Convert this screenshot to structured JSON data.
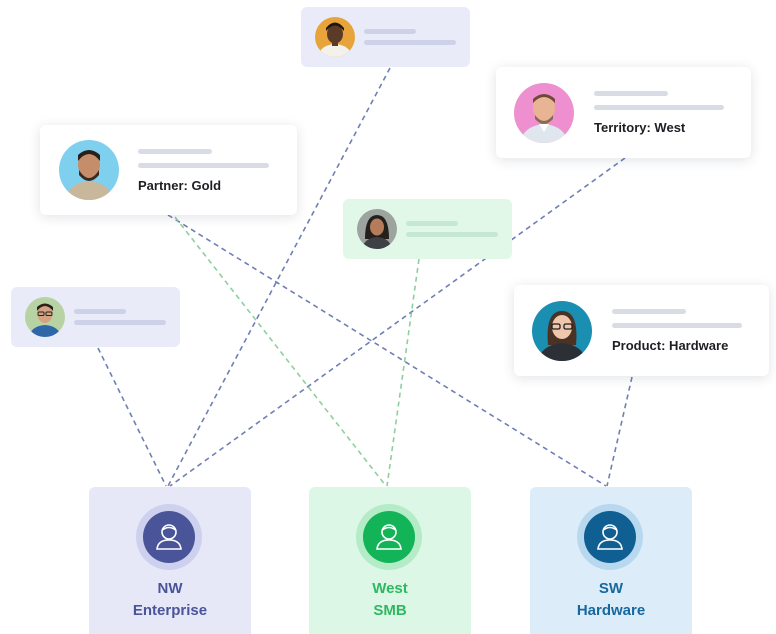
{
  "cards": {
    "partner": {
      "label": "Partner: Gold"
    },
    "territory": {
      "label": "Territory: West"
    },
    "product": {
      "label": "Product: Hardware"
    }
  },
  "teams": {
    "nw": {
      "line1": "NW",
      "line2": "Enterprise"
    },
    "west": {
      "line1": "West",
      "line2": "SMB"
    },
    "sw": {
      "line1": "SW",
      "line2": "Hardware"
    }
  },
  "colors": {
    "connector_blue": "#6f7fb5",
    "connector_green": "#8fcf9e",
    "nw_accent": "#4a5499",
    "west_accent": "#13b358",
    "sw_accent": "#0f5f93"
  }
}
